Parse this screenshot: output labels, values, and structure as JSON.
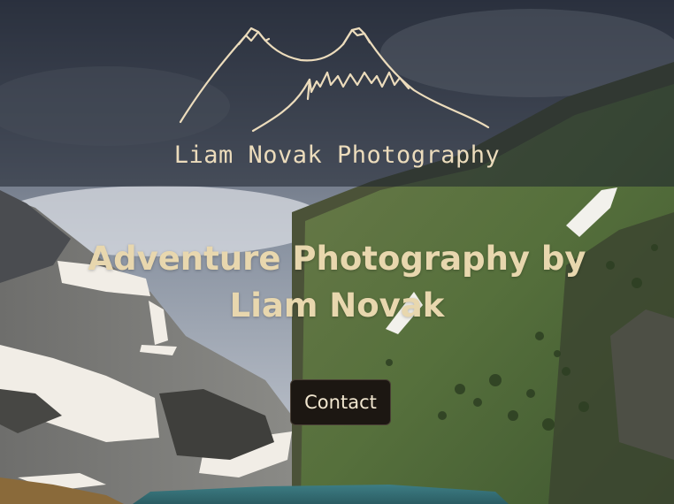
{
  "header": {
    "brand_name": "Liam Novak Photography",
    "logo_icon": "mountain-outline-logo"
  },
  "hero": {
    "title": "Adventure Photography by Liam Novak",
    "contact_label": "Contact"
  },
  "colors": {
    "text_cream": "#ecdcbc",
    "title_cream": "#e8d7ae",
    "button_bg": "#1c1712",
    "header_overlay": "rgba(30, 34, 46, 0.55)"
  }
}
